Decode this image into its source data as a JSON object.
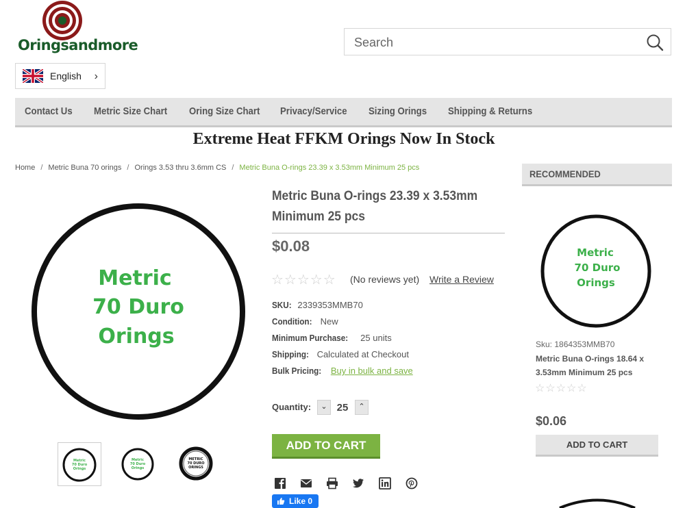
{
  "brand": {
    "logo_text": "Oringsandmore"
  },
  "search": {
    "placeholder": "Search"
  },
  "language": {
    "label": "English"
  },
  "nav": {
    "items": [
      "Contact Us",
      "Metric Size Chart",
      "Oring Size Chart",
      "Privacy/Service",
      "Sizing Orings",
      "Shipping & Returns"
    ]
  },
  "promo": "Extreme Heat FFKM Orings Now In Stock",
  "breadcrumb": [
    "Home",
    "Metric Buna 70 orings",
    "Orings 3.53 thru 3.6mm CS",
    "Metric Buna O-rings 23.39 x 3.53mm Minimum 25 pcs"
  ],
  "product": {
    "title_line1": "Metric Buna O-rings 23.39 x 3.53mm",
    "title_line2": "Minimum 25 pcs",
    "price": "$0.08",
    "reviews_text": "(No reviews yet)",
    "write_review": "Write a Review",
    "image_text": [
      "Metric",
      "70 Duro",
      "Orings"
    ],
    "thumb_text": [
      "METRIC",
      "70 DURO",
      "ORINGS"
    ],
    "specs": {
      "sku_label": "SKU:",
      "sku": "2339353MMB70",
      "condition_label": "Condition:",
      "condition": "New",
      "min_label": "Minimum Purchase:",
      "min": "25 units",
      "shipping_label": "Shipping:",
      "shipping": "Calculated at Checkout",
      "bulk_label": "Bulk Pricing:",
      "bulk": "Buy in bulk and save"
    },
    "quantity_label": "Quantity:",
    "quantity": "25",
    "add_to_cart": "ADD TO CART",
    "like_label": "Like 0"
  },
  "recommended": {
    "heading": "RECOMMENDED",
    "sku": "Sku: 1864353MMB70",
    "name": "Metric Buna O-rings 18.64 x 3.53mm Minimum 25 pcs",
    "price": "$0.06",
    "button": "ADD TO CART"
  },
  "colors": {
    "accent": "#7cb342",
    "nav_bg": "#e5e5e5",
    "ring_text": "#3cb04a",
    "logo_red": "#8b1a1a",
    "logo_green": "#1a5c2a"
  },
  "icons": [
    "search-icon",
    "uk-flag-icon",
    "chevron-right-icon",
    "facebook-icon",
    "email-icon",
    "print-icon",
    "twitter-icon",
    "linkedin-icon",
    "pinterest-icon"
  ]
}
